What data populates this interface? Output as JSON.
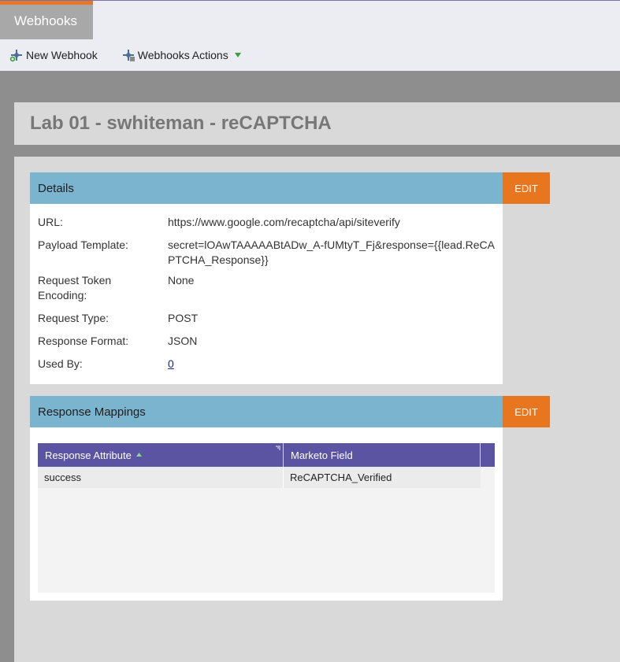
{
  "tabs": {
    "active_label": "Webhooks"
  },
  "toolbar": {
    "new_webhook_label": "New Webhook",
    "webhooks_actions_label": "Webhooks Actions"
  },
  "page": {
    "title": "Lab 01 - swhiteman - reCAPTCHA"
  },
  "details": {
    "header": "Details",
    "edit_label": "EDIT",
    "rows": [
      {
        "label": "URL:",
        "value": "https://www.google.com/recaptcha/api/siteverify"
      },
      {
        "label": "Payload Template:",
        "value": "secret=lOAwTAAAAABtADw_A-fUMtyT_Fj&response={{lead.ReCAPTCHA_Response}}"
      },
      {
        "label": "Request Token Encoding:",
        "value": "None"
      },
      {
        "label": "Request Type:",
        "value": "POST"
      },
      {
        "label": "Response Format:",
        "value": "JSON"
      },
      {
        "label": "Used By:",
        "value": "0"
      }
    ]
  },
  "mappings": {
    "header": "Response Mappings",
    "edit_label": "EDIT",
    "columns": [
      "Response Attribute",
      "Marketo Field"
    ],
    "rows": [
      [
        "success",
        "ReCAPTCHA_Verified"
      ]
    ]
  },
  "colors": {
    "accent_orange": "#e8761f",
    "panel_header_blue": "#7ab4cf",
    "grid_header_purple": "#5b54a2"
  },
  "icons": {
    "new_webhook": "webhook-add-icon",
    "actions": "webhook-actions-icon",
    "dropdown": "chevron-down-icon",
    "sort": "sort-asc-icon"
  }
}
